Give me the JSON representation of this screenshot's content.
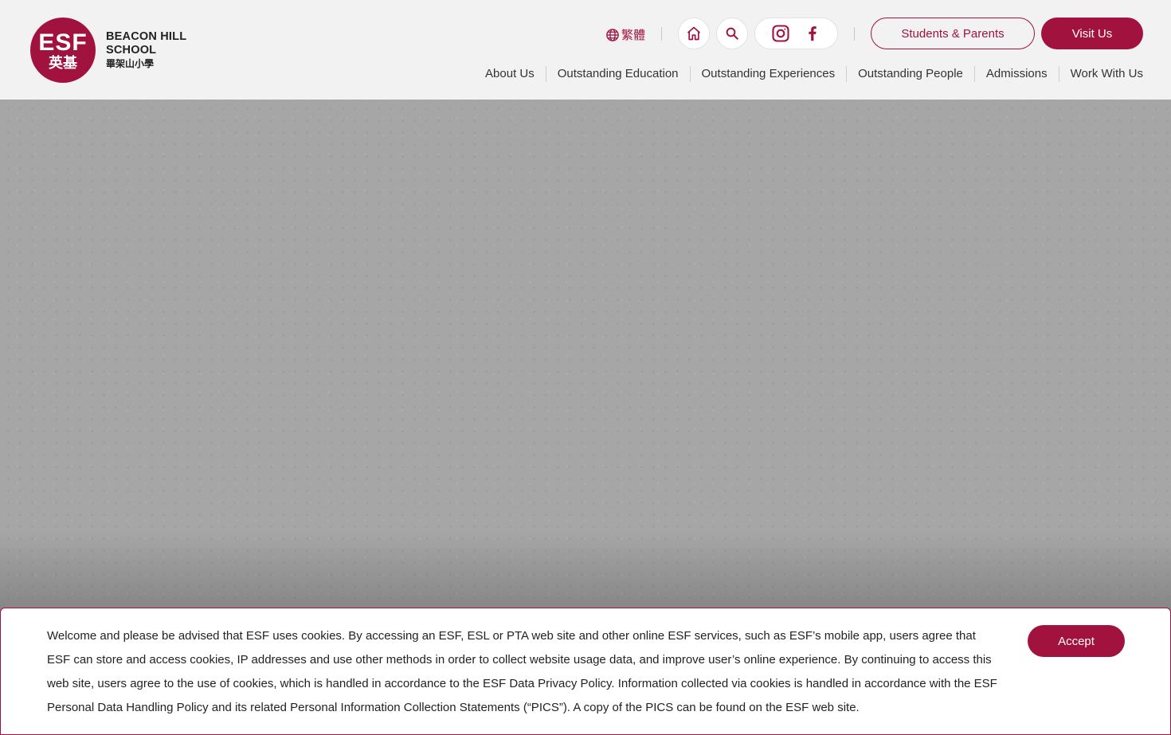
{
  "brand": {
    "logo_esf": "ESF",
    "logo_zh": "英基",
    "school_line1": "BEACON HILL",
    "school_line2": "SCHOOL",
    "school_zh": "畢架山小學",
    "accent_color": "#a2123f"
  },
  "topbar": {
    "language_label": "繁體",
    "home_icon": "home-icon",
    "search_icon": "search-icon",
    "social_icons": [
      "instagram-icon",
      "facebook-icon"
    ],
    "students_parents_label": "Students & Parents",
    "visit_us_label": "Visit Us"
  },
  "nav": {
    "items": [
      {
        "label": "About Us"
      },
      {
        "label": "Outstanding Education"
      },
      {
        "label": "Outstanding Experiences"
      },
      {
        "label": "Outstanding People"
      },
      {
        "label": "Admissions"
      },
      {
        "label": "Work With Us"
      }
    ]
  },
  "cookie": {
    "message": "Welcome and please be advised that ESF uses cookies. By accessing an ESF, ESL or PTA web site and other online ESF services, such as ESF’s mobile app, users agree that ESF can store and access cookies, IP addresses and use other methods in order to collect website usage data, and improve user’s online experience. By continuing to access this web site, users agree to the use of cookies, which is handled in accordance to the ESF Data Privacy Policy. Information collected via cookies is handled in accordance with the ESF Personal Data Handling Policy and its related Personal Information Collection Statements (“PICS”). A copy of the PICS can be found on the ESF web site.",
    "accept_label": "Accept"
  }
}
